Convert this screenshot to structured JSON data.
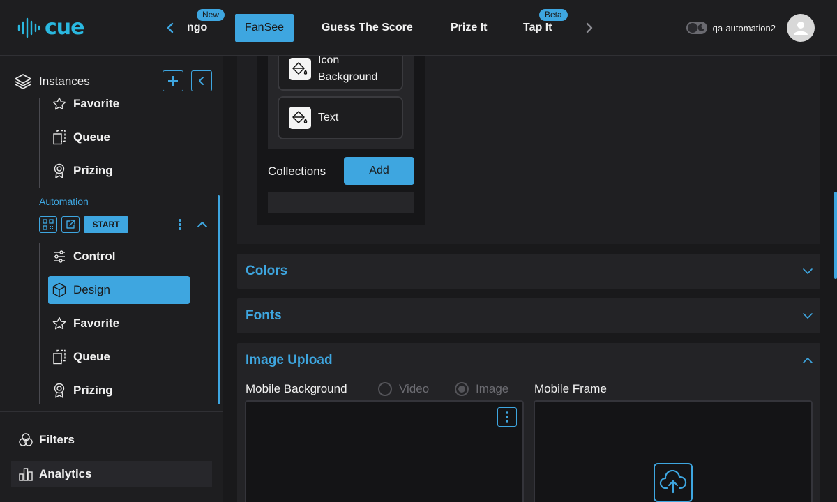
{
  "app": {
    "logo_text": "cue"
  },
  "header": {
    "tabs": [
      {
        "label": "ngo",
        "badge": "New"
      },
      {
        "label": "FanSee",
        "active": true
      },
      {
        "label": "Guess The Score"
      },
      {
        "label": "Prize It"
      },
      {
        "label": "Tap It",
        "badge": "Beta"
      }
    ],
    "username": "qa-automation2"
  },
  "sidebar": {
    "title": "Instances",
    "items_top": [
      {
        "label": "Favorite",
        "icon": "star-icon"
      },
      {
        "label": "Queue",
        "icon": "queue-icon"
      },
      {
        "label": "Prizing",
        "icon": "award-icon"
      }
    ],
    "automation_label": "Automation",
    "start_label": "START",
    "items_auto": [
      {
        "label": "Control",
        "icon": "sliders-icon"
      },
      {
        "label": "Design",
        "icon": "cube-icon",
        "active": true
      },
      {
        "label": "Favorite",
        "icon": "star-icon"
      },
      {
        "label": "Queue",
        "icon": "queue-icon"
      },
      {
        "label": "Prizing",
        "icon": "award-icon"
      }
    ],
    "footer": [
      {
        "label": "Filters",
        "icon": "filters-icon"
      },
      {
        "label": "Analytics",
        "icon": "analytics-icon",
        "selected": true
      }
    ]
  },
  "design": {
    "list_buttons": [
      {
        "label": "Icon Background",
        "icon": "paint-bucket-icon"
      },
      {
        "label": "Text",
        "icon": "paint-bucket-icon"
      }
    ],
    "collections_label": "Collections",
    "add_label": "Add",
    "sections": {
      "colors": "Colors",
      "fonts": "Fonts",
      "image_upload": "Image Upload"
    },
    "image_upload": {
      "mobile_background_label": "Mobile Background",
      "radio_video": "Video",
      "radio_image": "Image",
      "selected_type": "Image",
      "mobile_frame_label": "Mobile Frame"
    }
  },
  "colors": {
    "accent": "#3ea6e0",
    "background": "#1e1e20",
    "logo": "#2ab8e0"
  }
}
